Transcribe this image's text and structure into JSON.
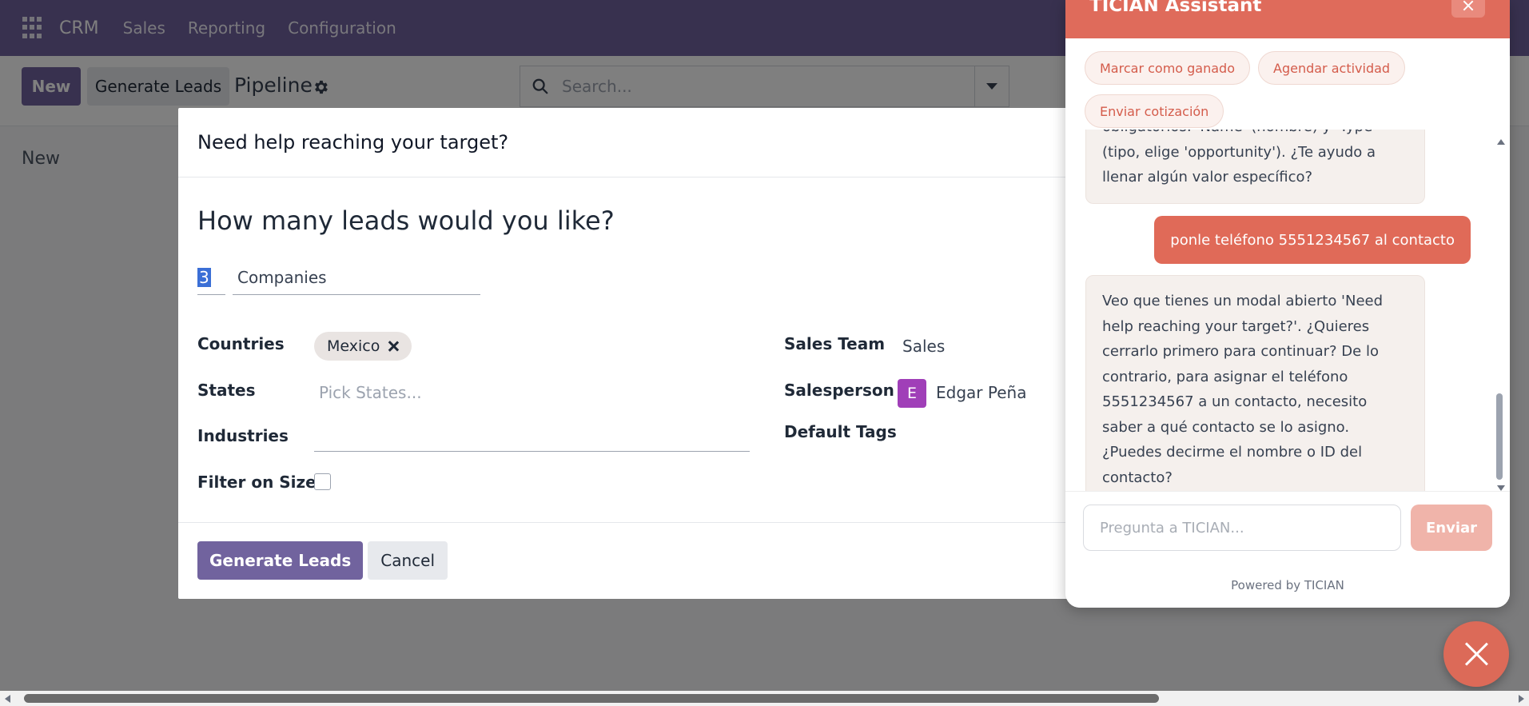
{
  "navbar": {
    "brand": "CRM",
    "menu": [
      "Sales",
      "Reporting",
      "Configuration"
    ]
  },
  "control_panel": {
    "new_label": "New",
    "generate_leads_label": "Generate Leads",
    "breadcrumb": "Pipeline",
    "search_placeholder": "Search..."
  },
  "kanban": {
    "column_title": "New"
  },
  "modal": {
    "title": "Need help reaching your target?",
    "question": "How many leads would you like?",
    "quantity": "3",
    "unit": "Companies",
    "labels": {
      "countries": "Countries",
      "states": "States",
      "industries": "Industries",
      "filter_on_size": "Filter on Size",
      "sales_team": "Sales Team",
      "salesperson": "Salesperson",
      "default_tags": "Default Tags"
    },
    "country_tag": "Mexico",
    "states_placeholder": "Pick States...",
    "sales_team_value": "Sales",
    "salesperson_initial": "E",
    "salesperson_name": "Edgar Peña",
    "filter_on_size_checked": false,
    "primary_button": "Generate Leads",
    "cancel_button": "Cancel"
  },
  "assistant": {
    "title": "TICIAN Assistant",
    "quick_actions": [
      "Marcar como ganado",
      "Agendar actividad",
      "Enviar cotización"
    ],
    "messages": [
      {
        "role": "assistant",
        "text": "obligatorios: 'Name' (nombre) y 'Type' (tipo, elige 'opportunity'). ¿Te ayudo a llenar algún valor específico?"
      },
      {
        "role": "user",
        "text": "ponle teléfono 5551234567 al contacto"
      },
      {
        "role": "assistant",
        "text": "Veo que tienes un modal abierto 'Need help reaching your target?'. ¿Quieres cerrarlo primero para continuar? De lo contrario, para asignar el teléfono 5551234567 a un contacto, necesito saber a qué contacto se lo asigno. ¿Puedes decirme el nombre o ID del contacto?"
      }
    ],
    "input_placeholder": "Pregunta a TICIAN...",
    "send_label": "Enviar",
    "footer": "Powered by TICIAN"
  },
  "colors": {
    "navbar": "#71639e",
    "primary": "#71639e",
    "assistant_accent": "#df6b5b",
    "user_bubble": "#e06a58",
    "avatar": "#a03fb8"
  }
}
